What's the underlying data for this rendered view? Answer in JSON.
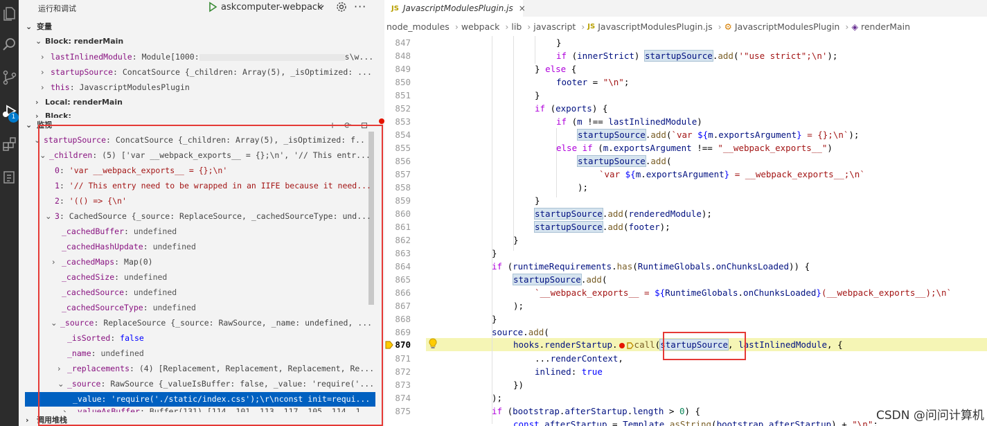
{
  "activity_bar": {
    "icons": [
      "files-icon",
      "search-icon",
      "source-control-icon",
      "run-debug-icon",
      "extensions-icon",
      "remote-icon"
    ],
    "debug_badge": "1",
    "accent_color": "#007acc"
  },
  "sidebar": {
    "title": "运行和调试",
    "run_config": "askcomputer-webpack",
    "variables_label": "变量",
    "watch_label": "监视",
    "callstack_label": "调用堆栈",
    "block_scope_1": "Block: renderMain",
    "local_scope": "Local: renderMain",
    "block_scope_2": "Block:",
    "variables": [
      {
        "key": "lastInlinedModule",
        "value": "Module[1000:",
        "suffix": "s\\w..."
      },
      {
        "key": "startupSource",
        "value": "ConcatSource {_children: Array(5), _isOptimized: ..."
      },
      {
        "key": "this",
        "value": "JavascriptModulesPlugin"
      }
    ],
    "watch": [
      {
        "key": "startupSource",
        "value": "ConcatSource {_children: Array(5), _isOptimized: f..."
      },
      {
        "key": "_children",
        "value": "(5) ['var __webpack_exports__ = {};\\n', '// This entr..."
      },
      {
        "key": "0",
        "value": "'var __webpack_exports__ = {};\\n'"
      },
      {
        "key": "1",
        "value": "'// This entry need to be wrapped in an IIFE because it need..."
      },
      {
        "key": "2",
        "value": "'(() => {\\n'"
      },
      {
        "key": "3",
        "value": "CachedSource {_source: ReplaceSource, _cachedSourceType: und..."
      },
      {
        "key": "_cachedBuffer",
        "value": "undefined"
      },
      {
        "key": "_cachedHashUpdate",
        "value": "undefined"
      },
      {
        "key": "_cachedMaps",
        "value": "Map(0)"
      },
      {
        "key": "_cachedSize",
        "value": "undefined"
      },
      {
        "key": "_cachedSource",
        "value": "undefined"
      },
      {
        "key": "_cachedSourceType",
        "value": "undefined"
      },
      {
        "key": "_source",
        "value": "ReplaceSource {_source: RawSource, _name: undefined, ..."
      },
      {
        "key": "_isSorted",
        "value": "false"
      },
      {
        "key": "_name",
        "value": "undefined"
      },
      {
        "key": "_replacements",
        "value": "(4) [Replacement, Replacement, Replacement, Re..."
      },
      {
        "key": "_source",
        "value": "RawSource {_valueIsBuffer: false, _value: 'require('..."
      },
      {
        "key": "_value",
        "value": "'require('./static/index.css');\\r\\nconst init=requi..."
      },
      {
        "key": "_valueAsBuffer",
        "value": "Buffer(131) [114, 101, 113, 117, 105, 114, 1..."
      }
    ]
  },
  "editor": {
    "tab_label": "JavascriptModulesPlugin.js",
    "tab_badge": "JS",
    "tab_close": "×",
    "breadcrumb": [
      "node_modules",
      "webpack",
      "lib",
      "javascript",
      "JavascriptModulesPlugin.js",
      "JavascriptModulesPlugin",
      "renderMain"
    ],
    "line_numbers": [
      "847",
      "848",
      "849",
      "850",
      "851",
      "852",
      "853",
      "854",
      "855",
      "856",
      "857",
      "858",
      "859",
      "860",
      "861",
      "862",
      "863",
      "864",
      "865",
      "866",
      "867",
      "868",
      "869",
      "870",
      "871",
      "872",
      "873",
      "874",
      "875"
    ],
    "active_line": "870"
  },
  "watermark": "CSDN @问问计算机"
}
